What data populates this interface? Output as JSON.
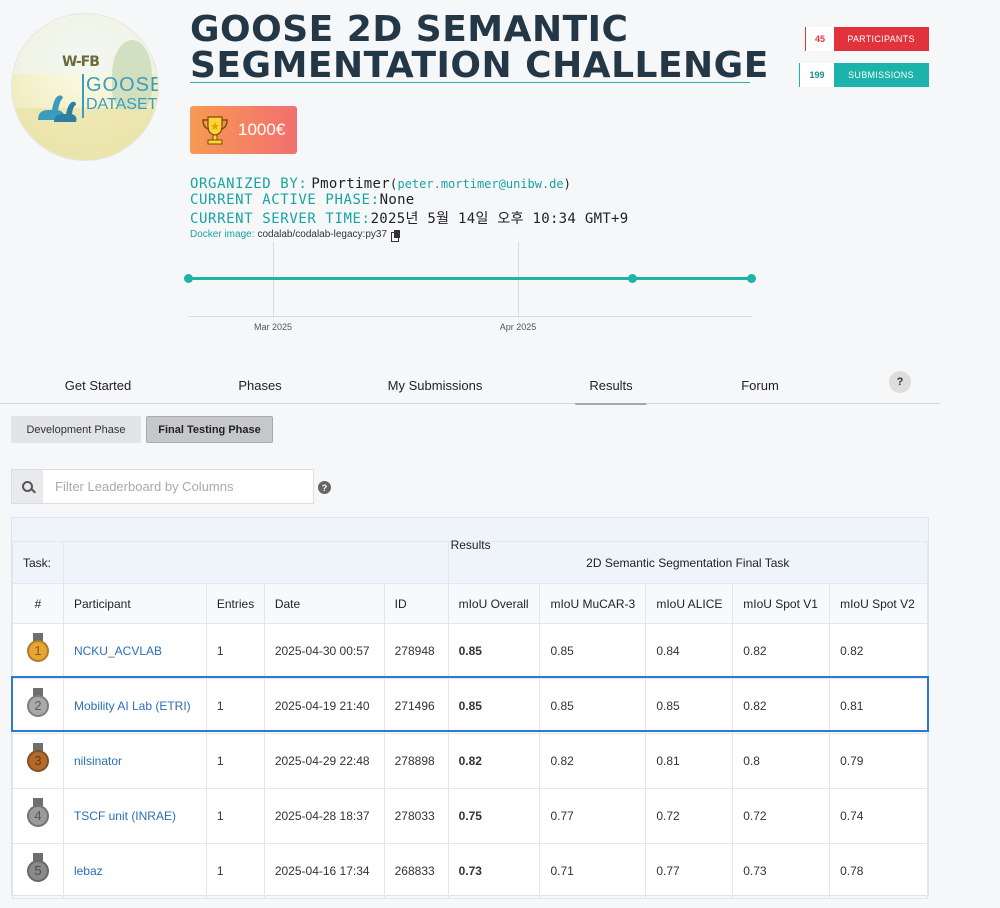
{
  "logo": {
    "line1": "W-FB",
    "line2": "GOOSE",
    "line3": "DATASET"
  },
  "competition": {
    "title": "GOOSE 2D SEMANTIC\nSEGMENTATION CHALLENGE",
    "prize": "1000€"
  },
  "stats": {
    "participants_count": "45",
    "participants_label": "PARTICIPANTS",
    "submissions_count": "199",
    "submissions_label": "SUBMISSIONS"
  },
  "info": {
    "organized_by_label": "ORGANIZED BY:",
    "organizer": "Pmortimer",
    "email": "peter.mortimer@unibw.de",
    "active_phase_label": "CURRENT ACTIVE PHASE:",
    "active_phase": "None",
    "server_time_label": "CURRENT SERVER TIME:",
    "server_time": "2025년 5월 14일 오후 10:34 GMT+9",
    "docker_label": "Docker image:",
    "docker_image": "codalab/codalab-legacy:py37"
  },
  "timeline": {
    "ticks": [
      "Mar 2025",
      "Apr 2025"
    ]
  },
  "tabs": [
    "Get Started",
    "Phases",
    "My Submissions",
    "Results",
    "Forum"
  ],
  "active_tab": "Results",
  "help_label": "?",
  "phases": [
    "Development Phase",
    "Final Testing Phase"
  ],
  "filter": {
    "placeholder": "Filter Leaderboard by Columns",
    "help": "?"
  },
  "leaderboard": {
    "task_label": "Task:",
    "results_label": "Results",
    "task_name": "2D Semantic Segmentation Final Task",
    "columns": [
      "#",
      "Participant",
      "Entries",
      "Date",
      "ID",
      "mIoU Overall",
      "mIoU MuCAR-3",
      "mIoU ALICE",
      "mIoU Spot V1",
      "mIoU Spot V2"
    ],
    "medal_colors": [
      "#e8a434",
      "#a9a9a9",
      "#b36a2a",
      "#9a9a9a",
      "#8a8a8a"
    ],
    "rows": [
      {
        "rank": "1",
        "participant": "NCKU_ACVLAB",
        "entries": "1",
        "date": "2025-04-30 00:57",
        "id": "278948",
        "overall": "0.85",
        "mucar": "0.85",
        "alice": "0.84",
        "spot1": "0.82",
        "spot2": "0.82"
      },
      {
        "rank": "2",
        "participant": "Mobility AI Lab (ETRI)",
        "entries": "1",
        "date": "2025-04-19 21:40",
        "id": "271496",
        "overall": "0.85",
        "mucar": "0.85",
        "alice": "0.85",
        "spot1": "0.82",
        "spot2": "0.81"
      },
      {
        "rank": "3",
        "participant": "nilsinator",
        "entries": "1",
        "date": "2025-04-29 22:48",
        "id": "278898",
        "overall": "0.82",
        "mucar": "0.82",
        "alice": "0.81",
        "spot1": "0.8",
        "spot2": "0.79"
      },
      {
        "rank": "4",
        "participant": "TSCF unit (INRAE)",
        "entries": "1",
        "date": "2025-04-28 18:37",
        "id": "278033",
        "overall": "0.75",
        "mucar": "0.77",
        "alice": "0.72",
        "spot1": "0.72",
        "spot2": "0.74"
      },
      {
        "rank": "5",
        "participant": "lebaz",
        "entries": "1",
        "date": "2025-04-16 17:34",
        "id": "268833",
        "overall": "0.73",
        "mucar": "0.71",
        "alice": "0.77",
        "spot1": "0.73",
        "spot2": "0.78"
      }
    ]
  },
  "colors": {
    "accent": "#1fb3a6",
    "title": "#233746",
    "participants": "#e2333d",
    "submissions": "#1bb3aa",
    "link": "#2a6ebb",
    "highlight": "#2a78d6"
  }
}
